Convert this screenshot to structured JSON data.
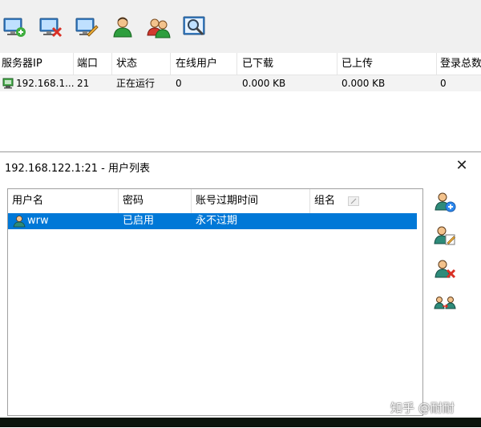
{
  "toolbar": {
    "icons": [
      "add-server-icon",
      "delete-server-icon",
      "edit-server-icon",
      "user-icon",
      "group-icon",
      "search-icon"
    ]
  },
  "server_table": {
    "columns": [
      "服务器IP",
      "端口",
      "状态",
      "在线用户",
      "已下载",
      "已上传",
      "登录总数"
    ],
    "rows": [
      {
        "ip": "192.168.1...",
        "port": "21",
        "status": "正在运行",
        "online": "0",
        "downloaded": "0.000 KB",
        "uploaded": "0.000 KB",
        "logins": "0"
      }
    ]
  },
  "dialog": {
    "title": "192.168.122.1:21 - 用户列表",
    "close": "✕",
    "columns": [
      "用户名",
      "密码",
      "账号过期时间",
      "组名"
    ],
    "rows": [
      {
        "username": "wrw",
        "password": "已启用",
        "expiry": "永不过期",
        "group": ""
      }
    ],
    "side_buttons": [
      "add-user-icon",
      "edit-user-icon",
      "delete-user-icon",
      "transfer-user-icon"
    ]
  },
  "watermark": "知乎 @耐耐",
  "colors": {
    "selection": "#0078d7",
    "toolbar": "#f0f0f0"
  }
}
